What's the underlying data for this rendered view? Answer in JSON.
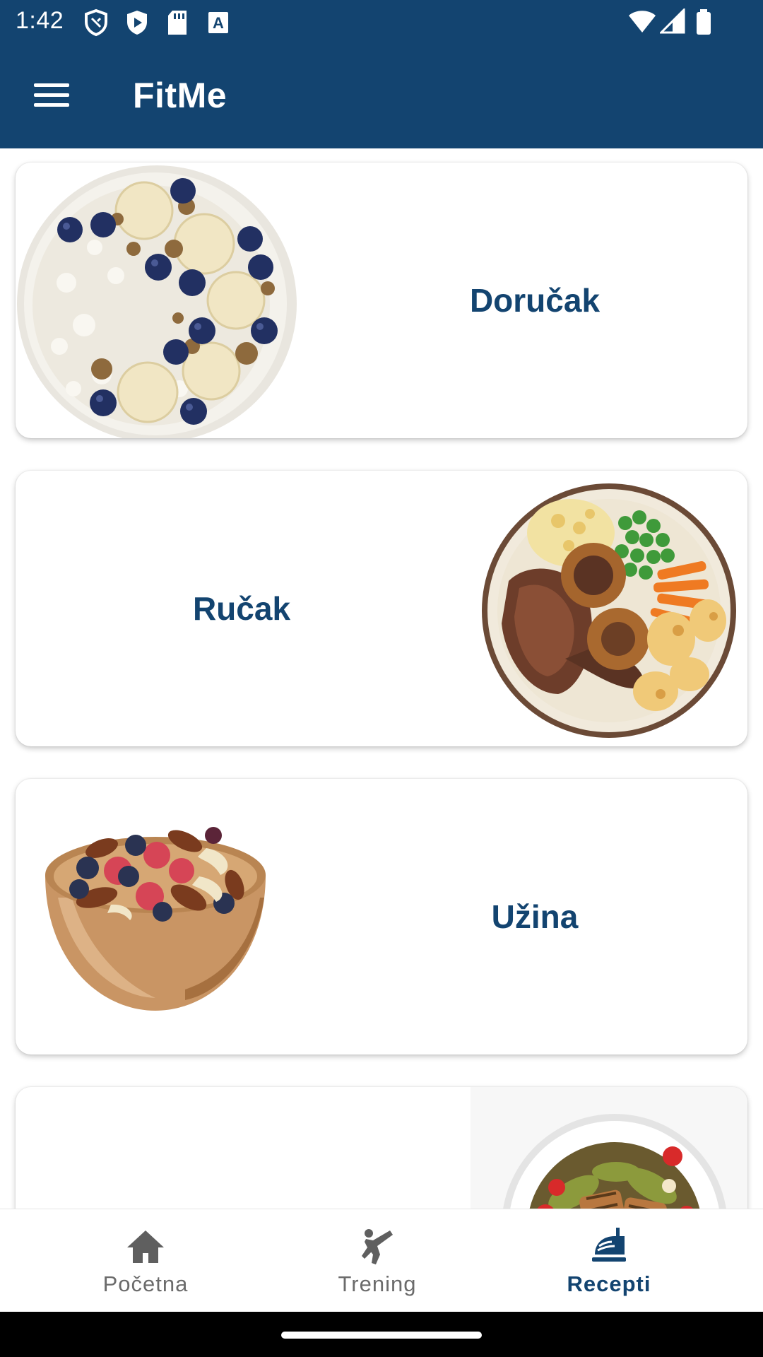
{
  "status_bar": {
    "time": "1:42",
    "left_icons": [
      "shield-icon",
      "play-shield-icon",
      "sd-card-icon",
      "text-a-icon"
    ],
    "right_icons": [
      "wifi-icon",
      "signal-icon",
      "battery-icon"
    ]
  },
  "app_bar": {
    "title": "FitMe",
    "menu_icon": "hamburger-menu-icon"
  },
  "cards": [
    {
      "label": "Doručak",
      "image": "oatmeal-bowl"
    },
    {
      "label": "Ručak",
      "image": "roast-dinner-plate"
    },
    {
      "label": "Užina",
      "image": "nuts-berries-bowl"
    },
    {
      "label": "",
      "image": "salad-plate"
    }
  ],
  "bottom_nav": {
    "items": [
      {
        "label": "Početna",
        "icon": "home-icon",
        "active": false
      },
      {
        "label": "Trening",
        "icon": "martial-arts-kick-icon",
        "active": false
      },
      {
        "label": "Recepti",
        "icon": "food-dish-icon",
        "active": true
      }
    ]
  },
  "colors": {
    "primary": "#134470",
    "nav_inactive": "#6b6b6b",
    "background": "#ffffff"
  }
}
